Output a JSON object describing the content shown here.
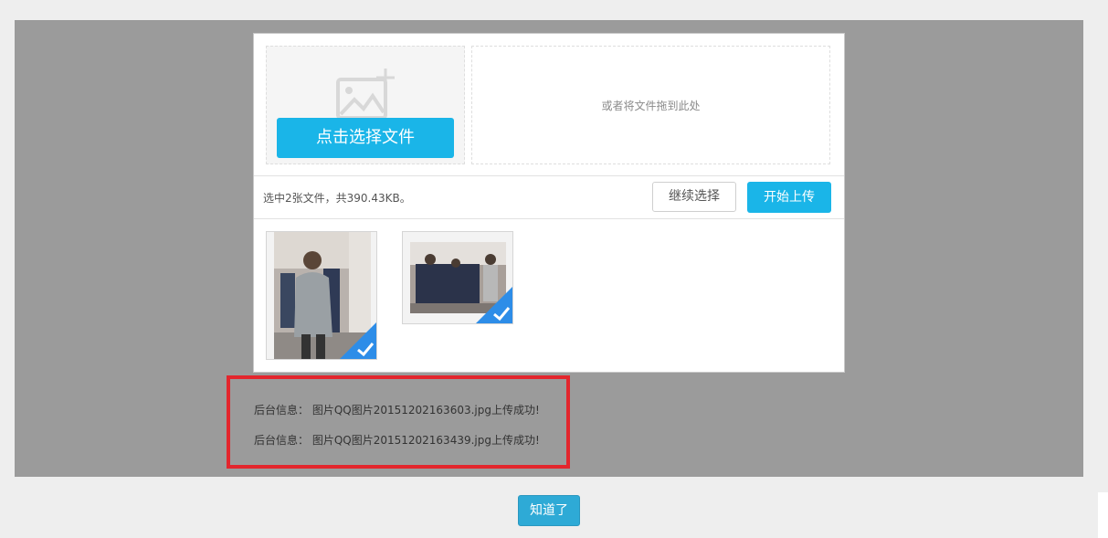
{
  "uploader": {
    "pick_button_label": "点击选择文件",
    "drop_hint": "或者将文件拖到此处",
    "status_text": "选中2张文件，共390.43KB。",
    "continue_button_label": "继续选择",
    "start_upload_button_label": "开始上传",
    "thumbnails": [
      {
        "icon": "check-icon",
        "selected": true
      },
      {
        "icon": "check-icon",
        "selected": true
      }
    ]
  },
  "log": {
    "lines": [
      "后台信息： 图片QQ图片20151202163603.jpg上传成功!",
      "后台信息： 图片QQ图片20151202163439.jpg上传成功!"
    ]
  },
  "dialog": {
    "ok_button_label": "知道了"
  },
  "colors": {
    "accent": "#1ab5e8",
    "highlight_border": "#e3262d",
    "backdrop": "#9b9b9b"
  }
}
